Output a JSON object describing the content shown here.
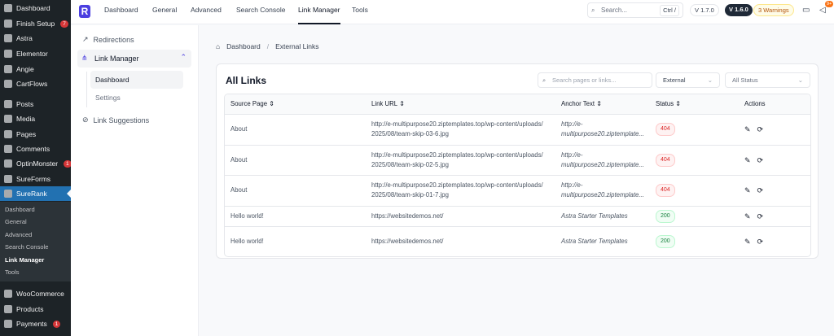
{
  "wp_menu": [
    {
      "label": "Dashboard"
    },
    {
      "label": "Finish Setup",
      "badge": "7"
    },
    {
      "label": "Astra"
    },
    {
      "label": "Elementor"
    },
    {
      "label": "Angie"
    },
    {
      "label": "CartFlows"
    },
    {
      "label": "Posts"
    },
    {
      "label": "Media"
    },
    {
      "label": "Pages"
    },
    {
      "label": "Comments"
    },
    {
      "label": "OptinMonster",
      "badge": "1"
    },
    {
      "label": "SureForms"
    },
    {
      "label": "SureRank"
    },
    {
      "label": "WooCommerce"
    },
    {
      "label": "Products"
    },
    {
      "label": "Payments",
      "badge": "1"
    }
  ],
  "wp_submenu": [
    "Dashboard",
    "General",
    "Advanced",
    "Search Console",
    "Link Manager",
    "Tools"
  ],
  "top": {
    "logo": "R",
    "tabs": [
      "Dashboard",
      "General",
      "Advanced",
      "Search Console",
      "Link Manager",
      "Tools"
    ],
    "search_placeholder": "Search...",
    "shortcut": "Ctrl /",
    "version_new": "V 1.7.0",
    "version_current": "V 1.6.0",
    "warnings": "3 Warnings",
    "notif_badge": "9+"
  },
  "nav": {
    "redirections": "Redirections",
    "link_manager": "Link Manager",
    "dashboard": "Dashboard",
    "settings": "Settings",
    "suggestions": "Link Suggestions"
  },
  "breadcrumb": [
    "Dashboard",
    "External Links"
  ],
  "card": {
    "title": "All Links",
    "search_placeholder": "Search pages or links...",
    "type_filter": "External",
    "status_filter": "All Status"
  },
  "table": {
    "headers": [
      "Source Page",
      "Link URL",
      "Anchor Text",
      "Status",
      "Actions"
    ],
    "rows": [
      {
        "source": "About",
        "url1": "http://e-multipurpose20.ziptemplates.top/wp-content/uploads/",
        "url2": "2025/08/team-skip-03-6.jpg",
        "anchor1": "http://e-",
        "anchor2": "multipurpose20.ziptemplate...",
        "status": "404"
      },
      {
        "source": "About",
        "url1": "http://e-multipurpose20.ziptemplates.top/wp-content/uploads/",
        "url2": "2025/08/team-skip-02-5.jpg",
        "anchor1": "http://e-",
        "anchor2": "multipurpose20.ziptemplate...",
        "status": "404"
      },
      {
        "source": "About",
        "url1": "http://e-multipurpose20.ziptemplates.top/wp-content/uploads/",
        "url2": "2025/08/team-skip-01-7.jpg",
        "anchor1": "http://e-",
        "anchor2": "multipurpose20.ziptemplate...",
        "status": "404"
      },
      {
        "source": "Hello world!",
        "url1": "https://websitedemos.net/",
        "url2": "",
        "anchor1": "Astra Starter Templates",
        "anchor2": "",
        "status": "200"
      },
      {
        "source": "Hello world!",
        "url1": "https://websitedemos.net/",
        "url2": "",
        "anchor1": "Astra Starter Templates",
        "anchor2": "",
        "status": "200"
      }
    ]
  }
}
